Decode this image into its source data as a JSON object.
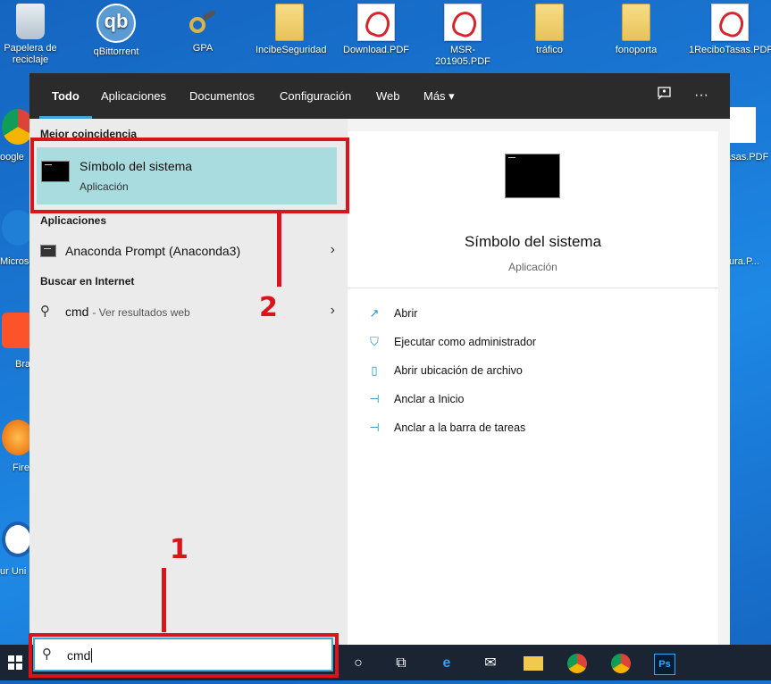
{
  "desktop": {
    "icons": [
      {
        "label": "Papelera de reciclaje",
        "icon": "recycle-bin-icon"
      },
      {
        "label": "qBittorrent",
        "icon": "qbittorrent-icon"
      },
      {
        "label": "GPA",
        "icon": "gpa-keys-icon"
      },
      {
        "label": "IncibeSeguridad",
        "icon": "folder-icon"
      },
      {
        "label": "Download.PDF",
        "icon": "pdf-icon"
      },
      {
        "label": "MSR-201905.PDF",
        "icon": "pdf-icon"
      },
      {
        "label": "tráfico",
        "icon": "folder-icon"
      },
      {
        "label": "fonoporta",
        "icon": "folder-icon"
      },
      {
        "label": "1ReciboTasas.PDF",
        "icon": "pdf-icon"
      }
    ],
    "side_labels": {
      "google": "oogle",
      "microsoft": "Microso",
      "brave": "Bra",
      "firefox": "Fire",
      "uni": "ur Uni",
      "pdf_right": "asas.PDF",
      "ura_right": "ura.P..."
    }
  },
  "search": {
    "tabs": [
      "Todo",
      "Aplicaciones",
      "Documentos",
      "Configuración",
      "Web",
      "Más ▾"
    ],
    "feedback_icon": "feedback-icon",
    "more_icon": "ellipsis-icon",
    "best_match_title": "Mejor coincidencia",
    "best_match": {
      "name": "Símbolo del sistema",
      "type": "Aplicación"
    },
    "apps_title": "Aplicaciones",
    "apps": [
      {
        "label": "Anaconda Prompt (Anaconda3)"
      }
    ],
    "web_title": "Buscar en Internet",
    "web": {
      "query": "cmd",
      "hint": "- Ver resultados web"
    },
    "detail": {
      "title": "Símbolo del sistema",
      "subtitle": "Aplicación",
      "actions": [
        "Abrir",
        "Ejecutar como administrador",
        "Abrir ubicación de archivo",
        "Anclar a Inicio",
        "Anclar a la barra de tareas"
      ]
    },
    "query": "cmd"
  },
  "annotations": {
    "step1": "1",
    "step2": "2",
    "color": "#d8151b"
  },
  "colors": {
    "accent": "#3aa8d8",
    "selection": "#a9dcdf",
    "panel": "#2b2b2b"
  }
}
